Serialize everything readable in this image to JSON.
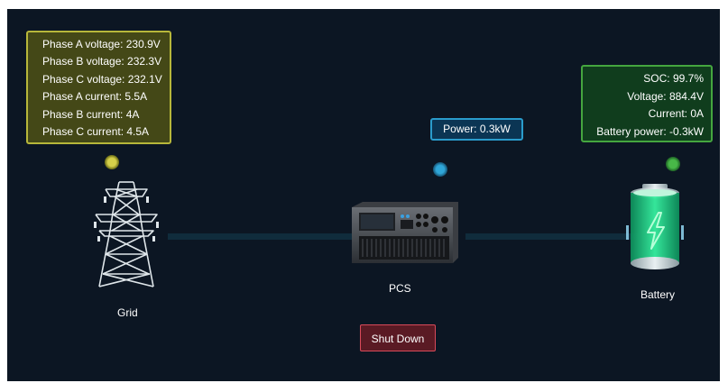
{
  "grid": {
    "label": "Grid",
    "info": [
      "Phase A voltage: 230.9V",
      "Phase B voltage: 232.3V",
      "Phase C voltage: 232.1V",
      "Phase A current: 5.5A",
      "Phase B current: 4A",
      "Phase C current: 4.5A"
    ],
    "icon": "power-tower-icon",
    "color": "#b7b73a"
  },
  "pcs": {
    "label": "PCS",
    "power": "Power: 0.3kW",
    "icon": "pcs-device-icon",
    "color": "#2a9ccc"
  },
  "battery": {
    "label": "Battery",
    "info": [
      "SOC: 99.7%",
      "Voltage: 884.4V",
      "Current: 0A",
      "Battery power: -0.3kW"
    ],
    "icon": "battery-icon",
    "color": "#45a63f"
  },
  "actions": {
    "shutdown_label": "Shut Down",
    "shutdown_color": "#d94a5a"
  }
}
